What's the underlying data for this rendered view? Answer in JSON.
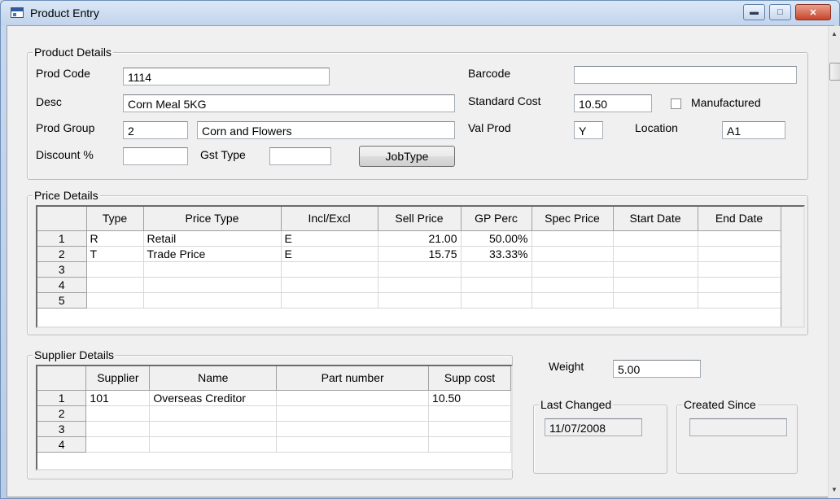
{
  "window": {
    "title": "Product Entry"
  },
  "product_details": {
    "legend": "Product Details",
    "prod_code_label": "Prod Code",
    "prod_code": "1114",
    "desc_label": "Desc",
    "desc": "Corn Meal 5KG",
    "prod_group_label": "Prod Group",
    "prod_group_code": "2",
    "prod_group_name": "Corn and Flowers",
    "discount_label": "Discount %",
    "discount": "",
    "gst_type_label": "Gst Type",
    "gst_type": "",
    "jobtype_button": "JobType",
    "barcode_label": "Barcode",
    "barcode": "",
    "standard_cost_label": "Standard Cost",
    "standard_cost": "10.50",
    "manufactured_label": "Manufactured",
    "manufactured_checked": false,
    "val_prod_label": "Val Prod",
    "val_prod": "Y",
    "location_label": "Location",
    "location": "A1"
  },
  "price_details": {
    "legend": "Price Details",
    "columns": [
      "Type",
      "Price Type",
      "Incl/Excl",
      "Sell Price",
      "GP Perc",
      "Spec Price",
      "Start Date",
      "End Date"
    ],
    "rows": [
      {
        "num": "1",
        "type": "R",
        "price_type": "Retail",
        "incl_excl": "E",
        "sell_price": "21.00",
        "gp_perc": "50.00%",
        "spec_price": "",
        "start_date": "",
        "end_date": ""
      },
      {
        "num": "2",
        "type": "T",
        "price_type": "Trade Price",
        "incl_excl": "E",
        "sell_price": "15.75",
        "gp_perc": "33.33%",
        "spec_price": "",
        "start_date": "",
        "end_date": ""
      },
      {
        "num": "3",
        "type": "",
        "price_type": "",
        "incl_excl": "",
        "sell_price": "",
        "gp_perc": "",
        "spec_price": "",
        "start_date": "",
        "end_date": ""
      },
      {
        "num": "4",
        "type": "",
        "price_type": "",
        "incl_excl": "",
        "sell_price": "",
        "gp_perc": "",
        "spec_price": "",
        "start_date": "",
        "end_date": ""
      },
      {
        "num": "5",
        "type": "",
        "price_type": "",
        "incl_excl": "",
        "sell_price": "",
        "gp_perc": "",
        "spec_price": "",
        "start_date": "",
        "end_date": ""
      }
    ]
  },
  "supplier_details": {
    "legend": "Supplier Details",
    "columns": [
      "Supplier",
      "Name",
      "Part number",
      "Supp cost"
    ],
    "rows": [
      {
        "num": "1",
        "supplier": "101",
        "name": "Overseas Creditor",
        "part_number": "",
        "supp_cost": "10.50"
      },
      {
        "num": "2",
        "supplier": "",
        "name": "",
        "part_number": "",
        "supp_cost": ""
      },
      {
        "num": "3",
        "supplier": "",
        "name": "",
        "part_number": "",
        "supp_cost": ""
      },
      {
        "num": "4",
        "supplier": "",
        "name": "",
        "part_number": "",
        "supp_cost": ""
      }
    ]
  },
  "misc": {
    "weight_label": "Weight",
    "weight": "5.00",
    "last_changed_legend": "Last Changed",
    "last_changed": "11/07/2008",
    "created_since_legend": "Created Since",
    "created_since": ""
  },
  "icons": {
    "app": "window-app-icon",
    "minimize": "minimize-icon",
    "maximize": "maximize-icon",
    "close": "close-icon"
  }
}
